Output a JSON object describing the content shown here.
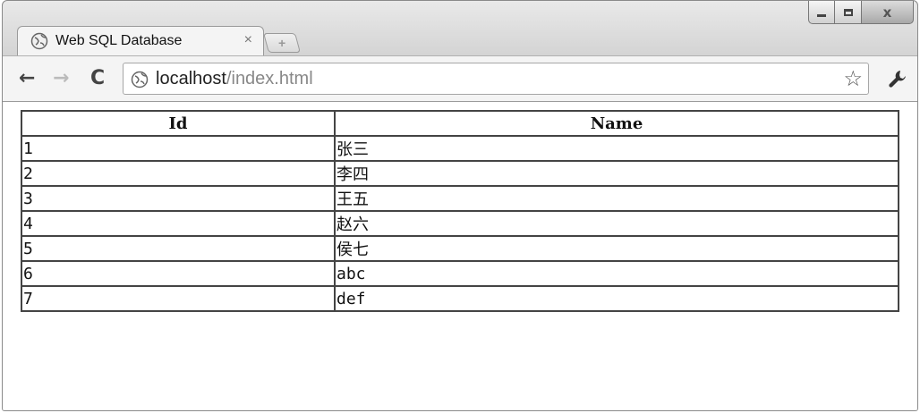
{
  "tab": {
    "title": "Web SQL Database",
    "close": "×",
    "new_tab": "+"
  },
  "toolbar": {
    "back": "←",
    "forward": "→",
    "reload": "C",
    "url_host": "localhost",
    "url_path": "/index.html",
    "star": "☆",
    "wrench": "🔧"
  },
  "window_controls": {
    "close": "x"
  },
  "table": {
    "headers": [
      "Id",
      "Name"
    ],
    "rows": [
      [
        "1",
        "张三"
      ],
      [
        "2",
        "李四"
      ],
      [
        "3",
        "王五"
      ],
      [
        "4",
        "赵六"
      ],
      [
        "5",
        "侯七"
      ],
      [
        "6",
        "abc"
      ],
      [
        "7",
        "def"
      ]
    ]
  }
}
